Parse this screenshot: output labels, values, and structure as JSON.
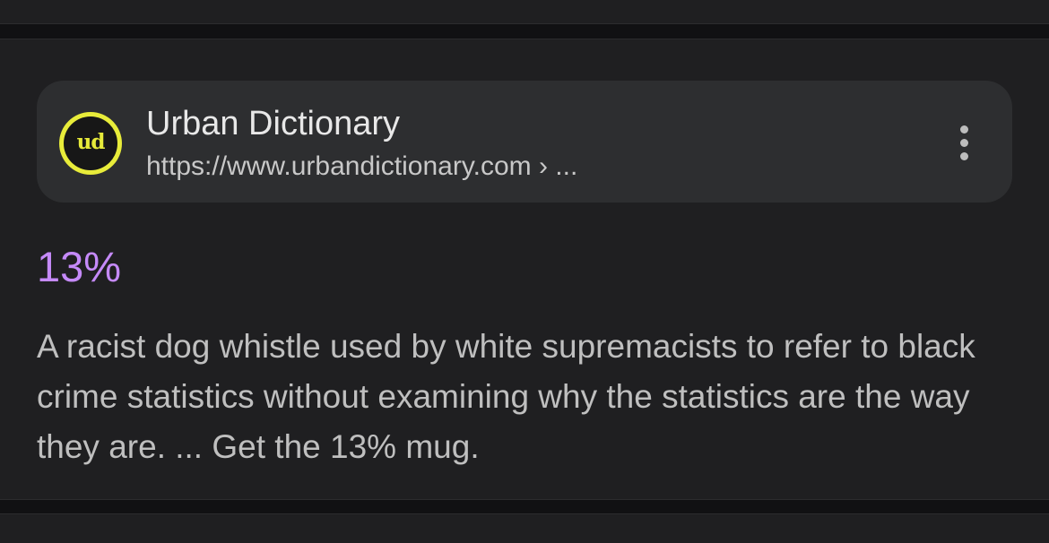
{
  "result": {
    "source": {
      "favicon_text": "ud",
      "favicon_icon": "urban-dictionary-logo",
      "site_name": "Urban Dictionary",
      "url": "https://www.urbandictionary.com › ...",
      "more_icon": "three-dot-vertical-icon"
    },
    "title": "13%",
    "snippet": "A racist dog whistle used by white supremacists to refer to black crime statistics without examining why the statistics are the way they are. ... Get the 13% mug."
  },
  "colors": {
    "background": "#111113",
    "card": "#1f1f21",
    "chip": "#2d2e30",
    "title_link": "#c58af9",
    "favicon_ring": "#e8ec3a"
  }
}
